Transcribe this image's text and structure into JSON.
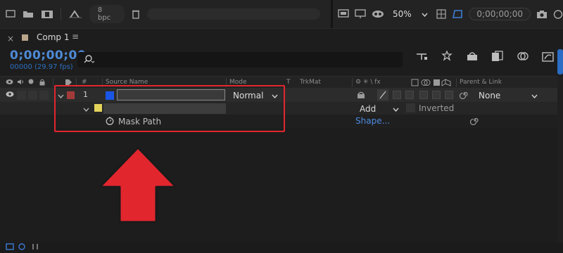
{
  "toolbar": {
    "bit_depth": "8 bpc",
    "zoom": "50%",
    "timecode": "0;00;00;00"
  },
  "panel": {
    "close": "×",
    "comp_name": "Comp 1",
    "menu": "≡"
  },
  "time": {
    "current": "0;00;00;00",
    "frames_fps": "00000 (29.97 fps)"
  },
  "columns": {
    "number": "#",
    "source_name": "Source Name",
    "mode": "Mode",
    "t": "T",
    "trkmat": "TrkMat",
    "switches": "⚙ ✳ \\ fx",
    "parent": "Parent & Link"
  },
  "layer": {
    "number": "1",
    "mode": "Normal",
    "parent": "None",
    "label_color": "#1a56e6",
    "row_label_color": "#a33a3a"
  },
  "mask": {
    "mode": "Add",
    "inverted_label": "Inverted",
    "label_color": "#e3d35a",
    "path_label": "Mask Path",
    "path_value": "Shape..."
  },
  "colors": {
    "accent": "#2d6fc0",
    "highlight": "#e2262e"
  }
}
